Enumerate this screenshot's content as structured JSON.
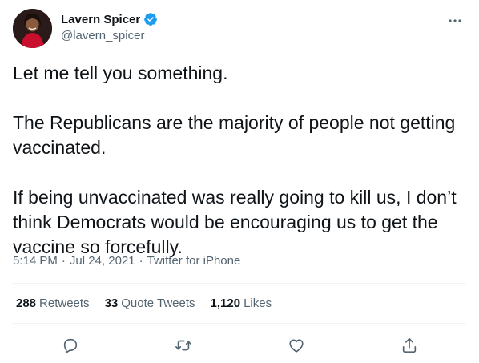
{
  "author": {
    "display_name": "Lavern Spicer",
    "handle": "@lavern_spicer",
    "verified": true
  },
  "tweet": {
    "text": "Let me tell you something.\n\nThe Republicans are the majority of people not getting vaccinated.\n\nIf being unvaccinated was really going to kill us, I don’t think Democrats would be encouraging us to get the vaccine so forcefully.",
    "time": "5:14 PM",
    "separator": "·",
    "date": "Jul 24, 2021",
    "source": "Twitter for iPhone"
  },
  "stats": {
    "retweets_count": "288",
    "retweets_label": "Retweets",
    "quote_count": "33",
    "quote_label": "Quote Tweets",
    "likes_count": "1,120",
    "likes_label": "Likes"
  },
  "icons": {
    "reply": "reply-icon",
    "retweet": "retweet-icon",
    "like": "like-icon",
    "share": "share-icon",
    "more": "more-icon",
    "verified": "verified-badge-icon"
  },
  "colors": {
    "text_primary": "#0f1419",
    "text_secondary": "#536471",
    "verified_blue": "#1d9bf0",
    "divider": "#eff3f4"
  }
}
